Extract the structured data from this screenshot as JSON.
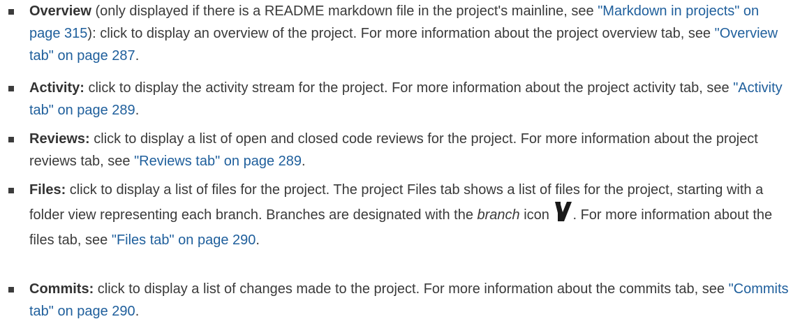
{
  "items": [
    {
      "title": "Overview",
      "text_before_link": " (only displayed if there is a README markdown file in the project's mainline, see ",
      "link1": "\"Markdown in projects\" on page 315",
      "text_mid": "): click to display an overview of the project. For more information about the project overview tab, see ",
      "link2": "\"Overview tab\" on page 287",
      "text_end": "."
    },
    {
      "title": "Activity:",
      "text": " click to display the activity stream for the project. For more information about the project activity tab, see ",
      "link": "\"Activity tab\" on page 289",
      "text_end": "."
    },
    {
      "title": "Reviews:",
      "text": " click to display a list of open and closed code reviews for the project. For more information about the project reviews tab, see ",
      "link": "\"Reviews tab\" on page 289",
      "text_end": "."
    },
    {
      "title": "Files:",
      "text": " click to display a list of files for the project. The project Files tab shows a list of files for the project, starting with a folder view representing each branch. Branches are designated with the ",
      "italic": "branch",
      "text_after_italic": " icon ",
      "icon": "branch-icon",
      "text_after_icon": ". For more information about the files tab, see ",
      "link": "\"Files tab\" on page 290",
      "text_end": "."
    },
    {
      "title": "Commits:",
      "text": " click to display a list of changes made to the project. For more information about the commits tab, see ",
      "link": "\"Commits tab\" on page 290",
      "text_end": "."
    }
  ],
  "colors": {
    "text": "#3a3a3a",
    "link": "#1f5f9c",
    "bullet": "#3c3c3c"
  }
}
